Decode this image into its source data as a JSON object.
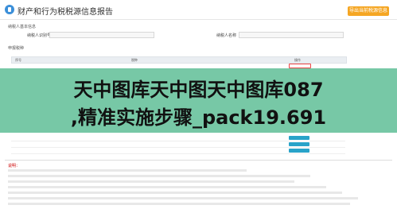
{
  "header": {
    "title": "财产和行为税税源信息报告",
    "export_label": "导出当前税源信息"
  },
  "sections": {
    "taxpayer": "纳税人基本信息",
    "report": "申报税种"
  },
  "fields": {
    "taxpayer_id_label": "纳税人识别号",
    "taxpayer_name_label": "纳税人名称"
  },
  "table": {
    "headers": [
      "序号",
      "税种",
      "操作"
    ]
  },
  "notes": {
    "title": "说明："
  },
  "watermark": {
    "line1": "天中图库天中图天中图库087",
    "line2": ",精准实施步骤_pack19.691"
  },
  "colors": {
    "accent": "#29a3c9",
    "export": "#f5a623",
    "watermark_band": "#5fbe96"
  }
}
